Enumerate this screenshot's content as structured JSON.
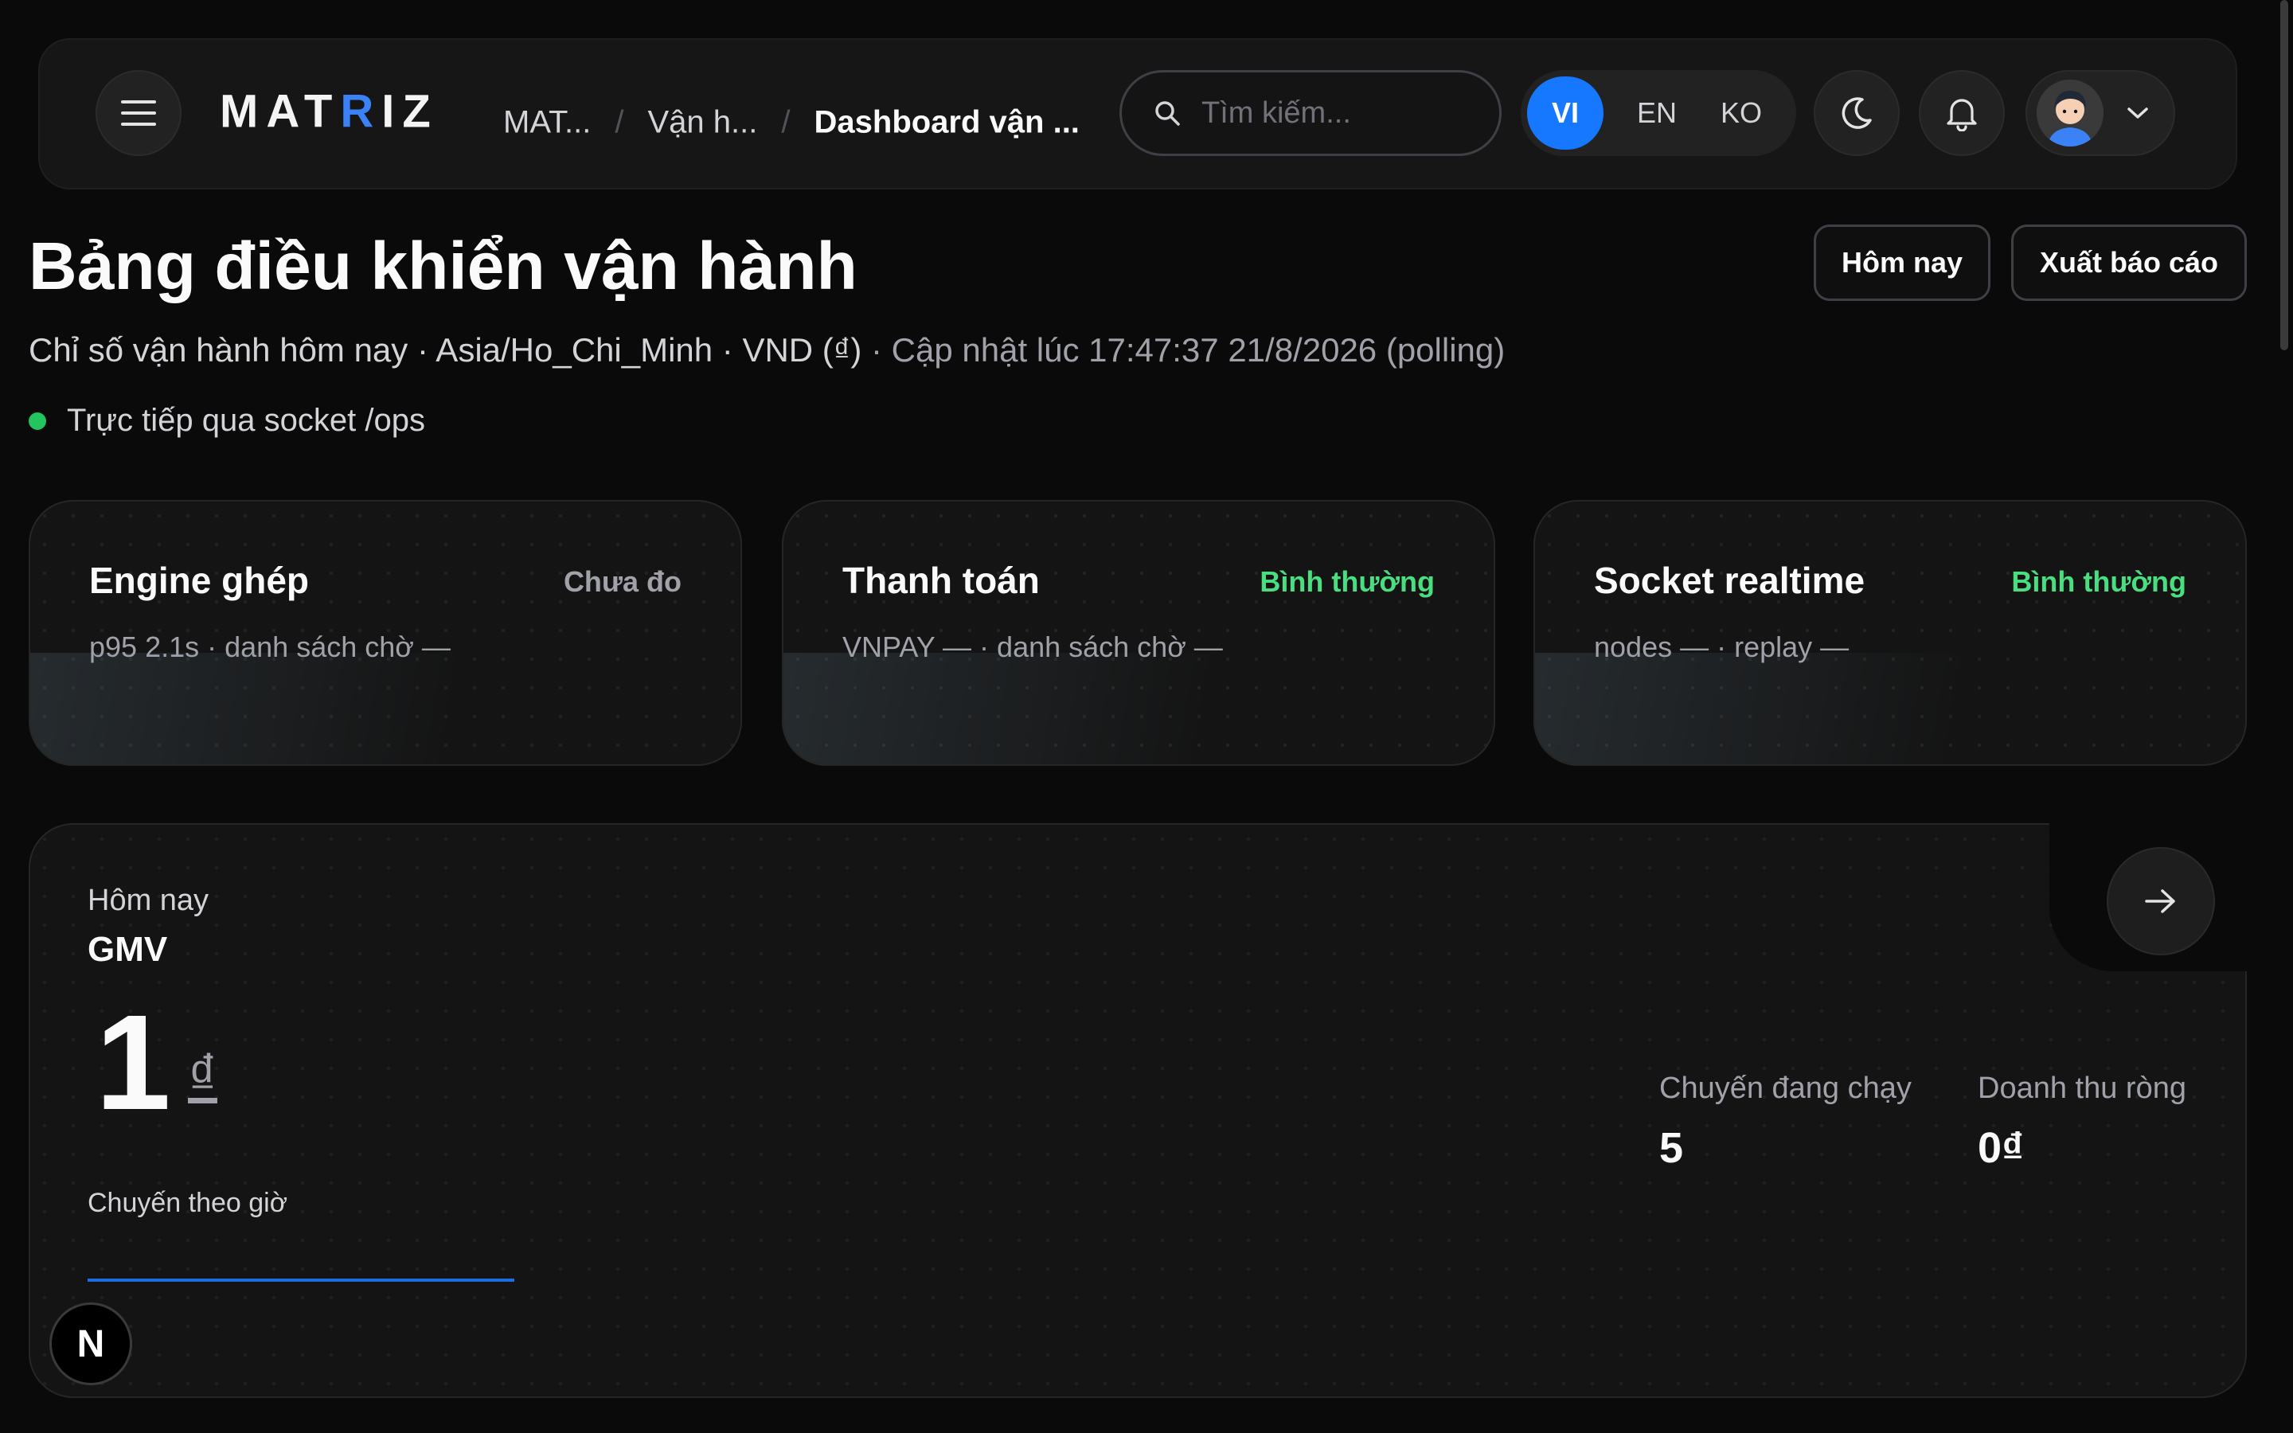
{
  "header": {
    "logo": {
      "main": "MAT",
      "accent": "R",
      "tail": "IZ"
    },
    "breadcrumbs": [
      "MAT...",
      "Vận h...",
      "Dashboard vận ..."
    ],
    "search_placeholder": "Tìm kiếm...",
    "languages": [
      "VI",
      "EN",
      "KO"
    ],
    "active_language": "VI"
  },
  "page": {
    "title": "Bảng điều khiển vận hành",
    "subtitle_main": "Chỉ số vận hành hôm nay · Asia/Ho_Chi_Minh · VND (₫)",
    "subtitle_updated": " · Cập nhật lúc 17:47:37 21/8/2026 (polling)",
    "live_status": "Trực tiếp qua socket /ops",
    "btn_today": "Hôm nay",
    "btn_export": "Xuất báo cáo"
  },
  "cards": [
    {
      "title": "Engine ghép",
      "status": "Chưa đo",
      "desc": "p95 2.1s · danh sách chờ —"
    },
    {
      "title": "Thanh toán",
      "status": "Bình thường",
      "desc": "VNPAY — · danh sách chờ —"
    },
    {
      "title": "Socket realtime",
      "status": "Bình thường",
      "desc": "nodes — · replay —"
    }
  ],
  "gmv": {
    "period": "Hôm nay",
    "metric": "GMV",
    "value": "1",
    "currency": "₫",
    "chart_label": "Chuyến theo giờ",
    "trips_label": "Chuyến đang chạy",
    "trips_value": "5",
    "revenue_label": "Doanh thu ròng",
    "revenue_value": "0₫"
  },
  "badge": "N",
  "colors": {
    "accent": "#1677ff",
    "ok": "#4ade80",
    "live": "#22c55e",
    "bg": "#0a0a0a"
  }
}
